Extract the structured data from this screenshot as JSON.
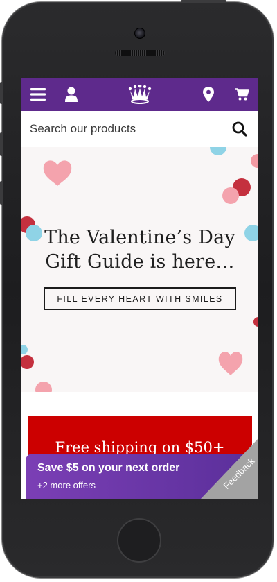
{
  "header": {
    "icons": [
      "menu-icon",
      "account-icon",
      "crown-logo",
      "location-pin-icon",
      "cart-icon"
    ],
    "brand_color": "#5e2a8c"
  },
  "search": {
    "placeholder": "Search our products"
  },
  "hero": {
    "title_line1": "The Valentine’s Day",
    "title_line2": "Gift Guide is here…",
    "button_label": "FILL EVERY HEART WITH SMILES"
  },
  "promo": {
    "text": "Free shipping on $50+",
    "color": "#cc0000"
  },
  "offer": {
    "title": "Save $5 on your next order",
    "subtitle": "+2 more offers"
  },
  "feedback": {
    "label": "Feedback"
  }
}
